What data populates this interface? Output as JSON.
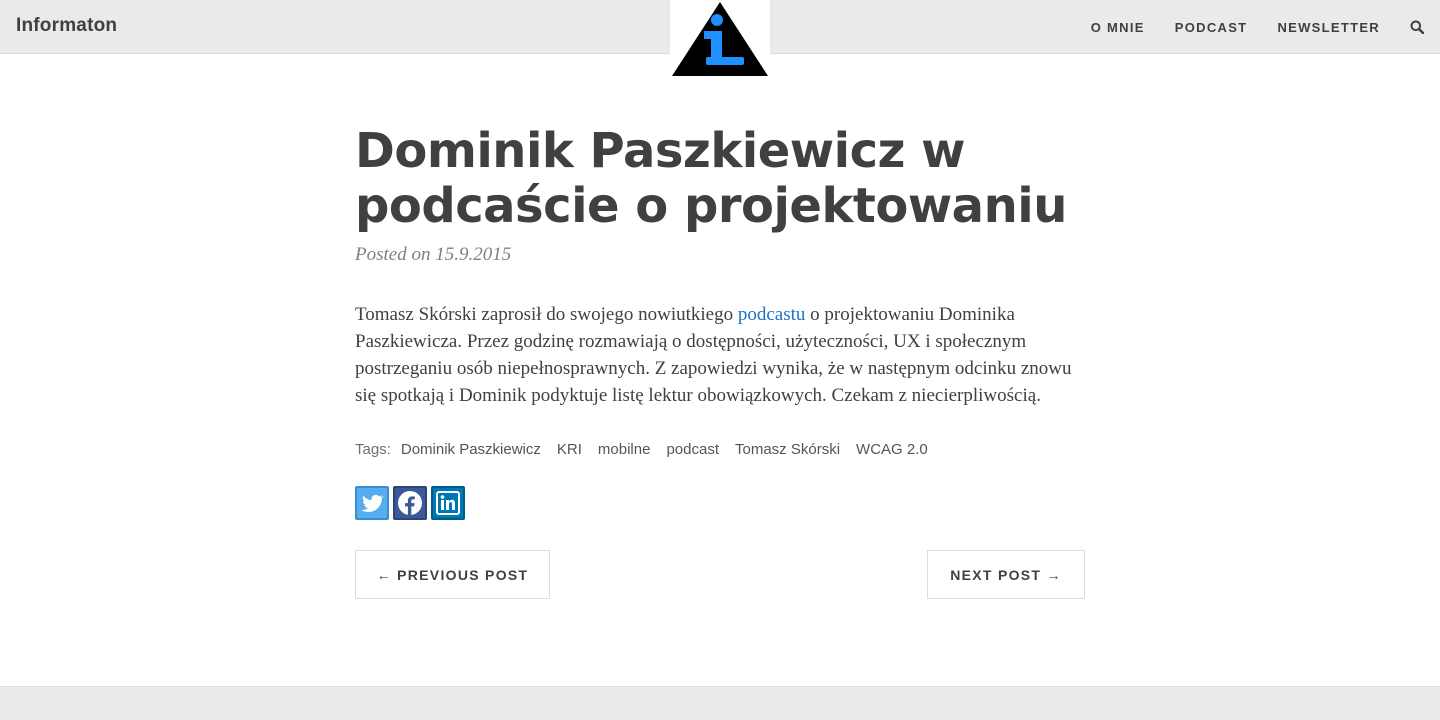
{
  "navbar": {
    "brand": "Informaton",
    "links": [
      "O MNIE",
      "PODCAST",
      "NEWSLETTER"
    ],
    "search_icon": "search-icon"
  },
  "logo": {
    "icon": "info-triangle-logo",
    "colors": {
      "triangle": "#000000",
      "letter": "#1e90ff"
    }
  },
  "post": {
    "title": "Dominik Paszkiewicz w podcaście o projektowaniu",
    "meta": "Posted on 15.9.2015",
    "body_before": "Tomasz Skórski zaprosił do swojego nowiutkiego ",
    "body_link": "podcastu",
    "body_after": " o projektowaniu Dominika Paszkiewicza. Przez godzinę rozmawiają o dostępności, użyteczności, UX i społecznym postrzeganiu osób niepełnosprawnych. Z zapowiedzi wynika, że w następnym odcinku znowu się spotkają i Dominik podyktuje listę lektur obowiązkowych. Czekam z niecierpliwością."
  },
  "tags": {
    "label": "Tags:",
    "items": [
      "Dominik Paszkiewicz",
      "KRI",
      "mobilne",
      "podcast",
      "Tomasz Skórski",
      "WCAG 2.0"
    ]
  },
  "share": {
    "icons": [
      "twitter-icon",
      "facebook-icon",
      "linkedin-icon"
    ],
    "colors": {
      "twitter": "#55acee",
      "facebook": "#3b5998",
      "linkedin": "#0077b5"
    }
  },
  "pager": {
    "prev": "← PREVIOUS POST",
    "next": "NEXT POST →"
  },
  "colors": {
    "navbar_bg": "#eaeaea",
    "text": "#404040",
    "link": "#1a73c9"
  }
}
